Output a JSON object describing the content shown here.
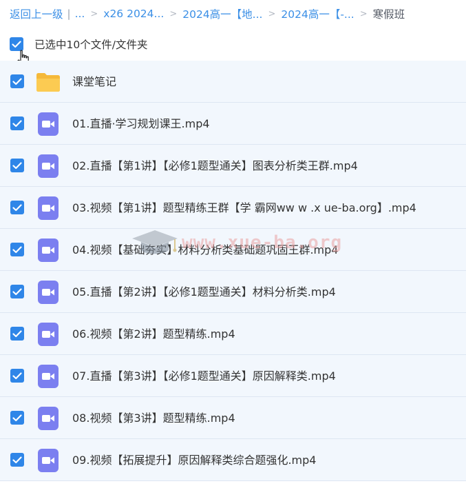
{
  "breadcrumb": {
    "back": "返回上一级",
    "separator": "|",
    "ellipsis": "...",
    "chevron": ">",
    "crumbs": [
      "x26 2024...",
      "2024高一【地...",
      "2024高一【-..."
    ],
    "current": "寒假班"
  },
  "selection": {
    "label": "已选中10个文件/文件夹",
    "checked": true
  },
  "files": [
    {
      "name": "课堂笔记",
      "type": "folder",
      "checked": true
    },
    {
      "name": "01.直播·学习规划课王.mp4",
      "type": "video",
      "checked": true
    },
    {
      "name": "02.直播【第1讲】【必修1题型通关】图表分析类王群.mp4",
      "type": "video",
      "checked": true
    },
    {
      "name": "03.视频【第1讲】题型精练王群【学 霸网ww w .x ue-ba.org】.mp4",
      "type": "video",
      "checked": true
    },
    {
      "name": "04.视频【基础夯实】材料分析类基础题巩固王群.mp4",
      "type": "video",
      "checked": true
    },
    {
      "name": "05.直播【第2讲】【必修1题型通关】材料分析类.mp4",
      "type": "video",
      "checked": true
    },
    {
      "name": "06.视频【第2讲】题型精练.mp4",
      "type": "video",
      "checked": true
    },
    {
      "name": "07.直播【第3讲】【必修1题型通关】原因解释类.mp4",
      "type": "video",
      "checked": true
    },
    {
      "name": "08.视频【第3讲】题型精练.mp4",
      "type": "video",
      "checked": true
    },
    {
      "name": "09.视频【拓展提升】原因解释类综合题强化.mp4",
      "type": "video",
      "checked": true
    }
  ],
  "watermark": {
    "text": "www.xue-ba.org"
  },
  "colors": {
    "accent": "#2f86e8",
    "link": "#3b8fe6",
    "row_bg": "#f2f7fd",
    "video_icon": "#7b7ff0",
    "folder_icon": "#fbc94b"
  }
}
